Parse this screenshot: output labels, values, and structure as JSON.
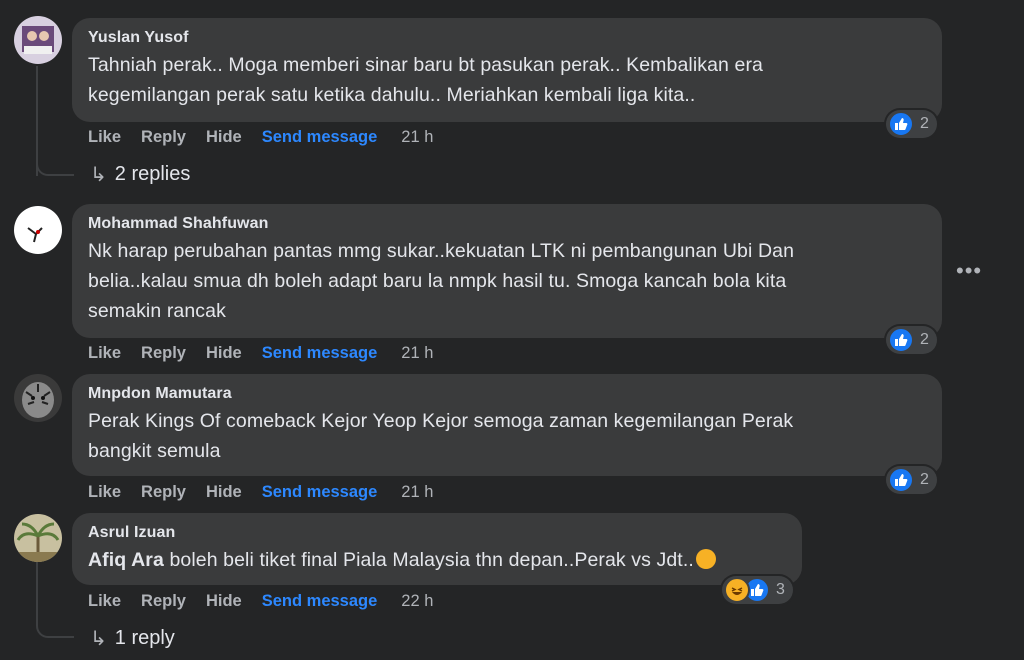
{
  "comments": [
    {
      "author": "Yuslan Yusof",
      "lines": [
        "Tahniah perak.. Moga memberi sinar baru bt pasukan perak.. Kembalikan era",
        "kegemilangan perak satu ketika dahulu.. Meriahkan kembali liga kita.."
      ],
      "actions": {
        "like": "Like",
        "reply": "Reply",
        "hide": "Hide",
        "send": "Send message",
        "time": "21 h"
      },
      "reaction_count": "2",
      "replies": "2 replies"
    },
    {
      "author": "Mohammad Shahfuwan",
      "lines": [
        "Nk harap perubahan pantas mmg sukar..kekuatan LTK ni pembangunan Ubi Dan",
        "belia..kalau smua dh boleh adapt baru la nmpk hasil tu. Smoga kancah bola kita",
        "semakin rancak"
      ],
      "actions": {
        "like": "Like",
        "reply": "Reply",
        "hide": "Hide",
        "send": "Send message",
        "time": "21 h"
      },
      "reaction_count": "2"
    },
    {
      "author": "Mnpdon Mamutara",
      "lines": [
        "Perak Kings Of comeback Kejor Yeop Kejor semoga zaman kegemilangan Perak",
        "bangkit semula"
      ],
      "actions": {
        "like": "Like",
        "reply": "Reply",
        "hide": "Hide",
        "send": "Send message",
        "time": "21 h"
      },
      "reaction_count": "2"
    },
    {
      "author": "Asrul Izuan",
      "mention": "Afiq Ara",
      "line_rest": " boleh beli tiket final Piala Malaysia thn depan..Perak vs Jdt..",
      "actions": {
        "like": "Like",
        "reply": "Reply",
        "hide": "Hide",
        "send": "Send message",
        "time": "22 h"
      },
      "reaction_count": "3",
      "replies": "1 reply"
    }
  ],
  "more_label": "•••",
  "colors": {
    "background": "#242526",
    "bubble": "#3a3b3c",
    "accent": "#2d88ff",
    "like": "#1877f2",
    "haha": "#f7b125"
  },
  "icons": [
    "like-icon",
    "haha-icon",
    "reply-arrow-icon",
    "more-options-icon"
  ]
}
